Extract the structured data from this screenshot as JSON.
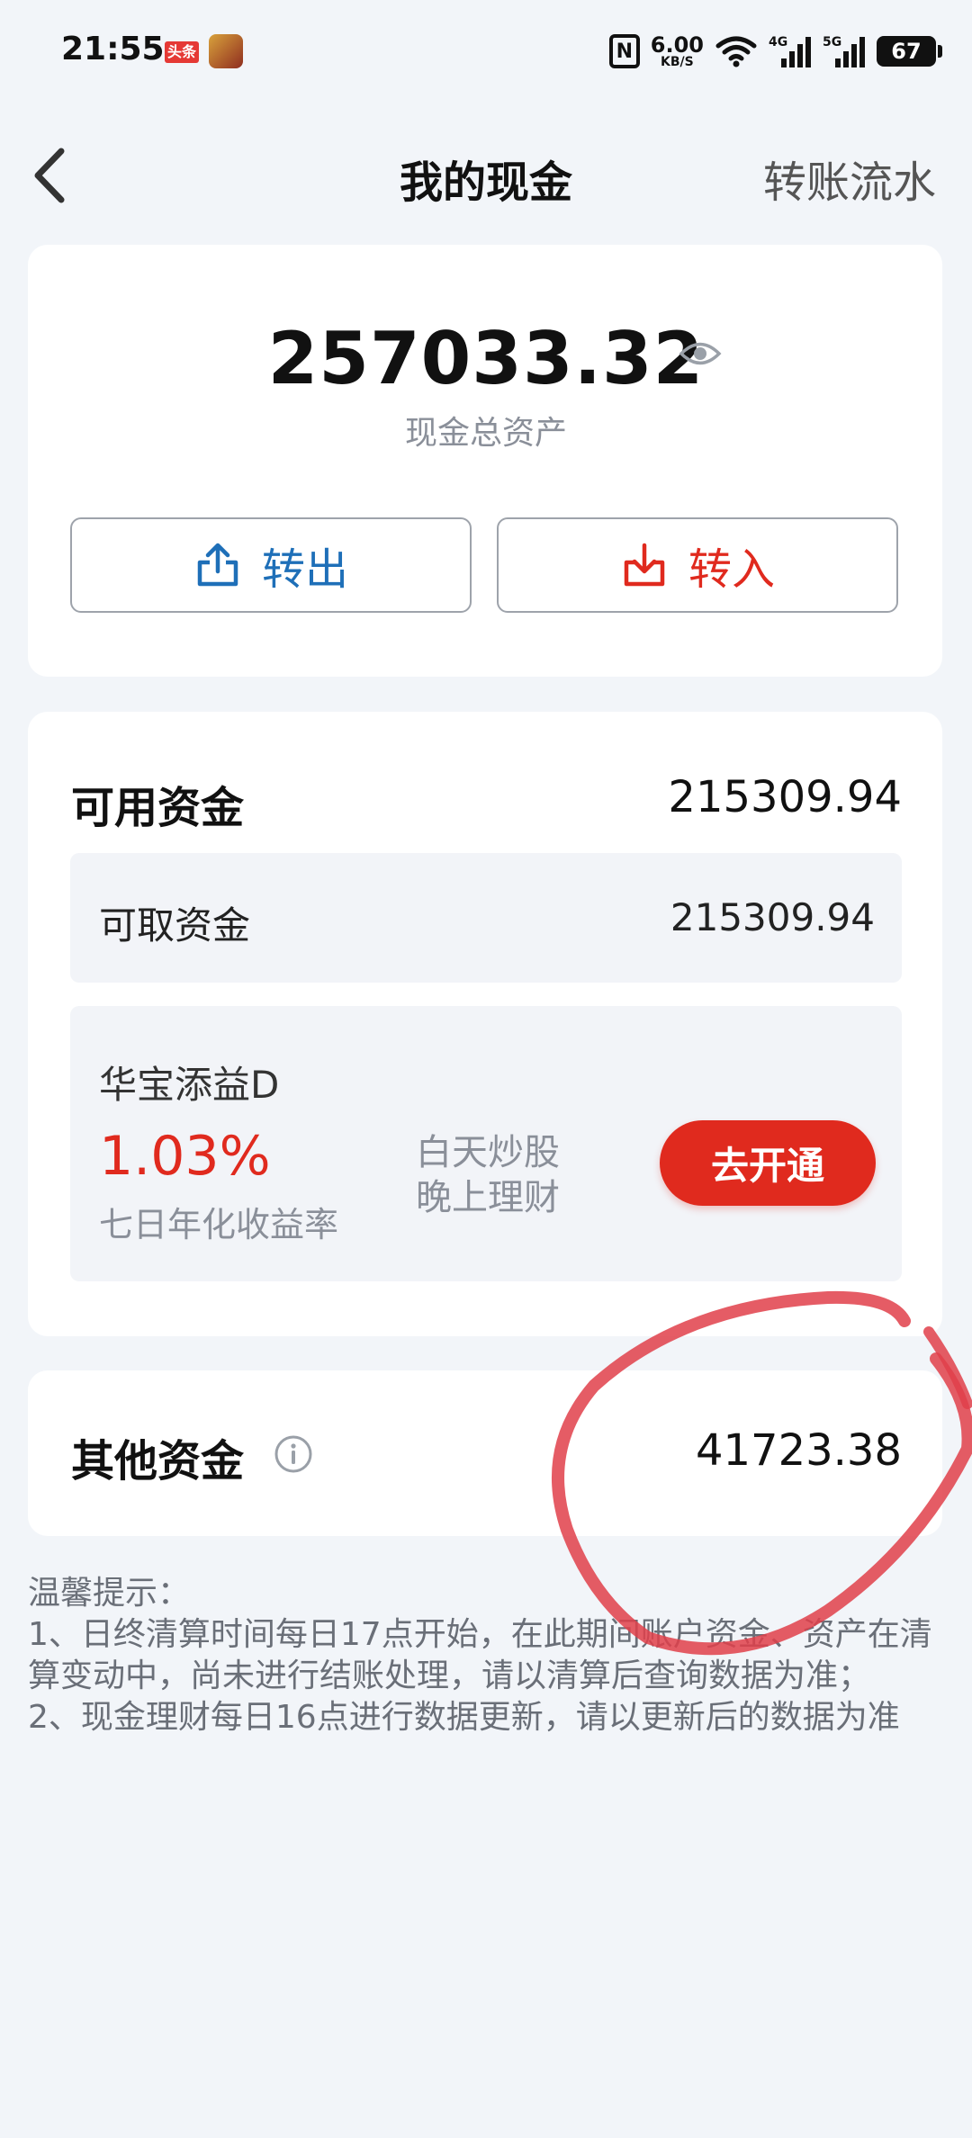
{
  "status_bar": {
    "time": "21:55",
    "news_badge": "头条",
    "nfc": "N",
    "net_speed_value": "6.00",
    "net_speed_unit": "KB/S",
    "signal_1": "4G",
    "signal_2": "5G",
    "battery": "67"
  },
  "nav": {
    "title": "我的现金",
    "right_link": "转账流水"
  },
  "summary": {
    "total_amount": "257033.32",
    "total_label": "现金总资产",
    "transfer_out_label": "转出",
    "transfer_in_label": "转入"
  },
  "available": {
    "label": "可用资金",
    "value": "215309.94",
    "withdrawable_label": "可取资金",
    "withdrawable_value": "215309.94"
  },
  "product": {
    "name": "华宝添益D",
    "rate": "1.03%",
    "rate_label": "七日年化收益率",
    "slogan_line1": "白天炒股",
    "slogan_line2": "晚上理财",
    "action_label": "去开通"
  },
  "other": {
    "label": "其他资金",
    "value": "41723.38"
  },
  "tips": {
    "title": "温馨提示：",
    "line1": "1、日终清算时间每日17点开始，在此期间账户资金、资产在清算变动中，尚未进行结账处理，请以清算后查询数据为准；",
    "line2": "2、现金理财每日16点进行数据更新，请以更新后的数据为准"
  },
  "colors": {
    "accent_red": "#e02a1e",
    "accent_blue": "#1e6fb8",
    "background": "#f2f5f9",
    "annotation_red": "#e0404a"
  },
  "icons": [
    "back-icon",
    "eye-icon",
    "upload-icon",
    "download-icon",
    "info-icon",
    "nfc-icon",
    "wifi-icon",
    "battery-icon"
  ]
}
